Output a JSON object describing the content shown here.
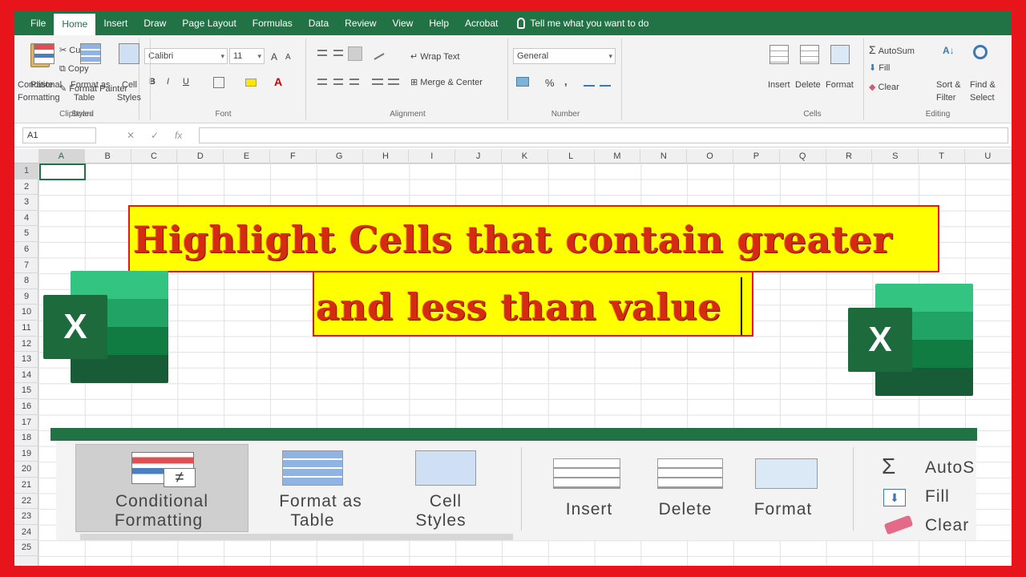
{
  "ribbon_tabs": [
    "File",
    "Home",
    "Insert",
    "Draw",
    "Page Layout",
    "Formulas",
    "Data",
    "Review",
    "View",
    "Help",
    "Acrobat"
  ],
  "tell_me": "Tell me what you want to do",
  "clipboard": {
    "paste": "Paste",
    "cut": "Cut",
    "copy": "Copy",
    "format_painter": "Format Painter",
    "label": "Clipboard"
  },
  "font": {
    "name": "Calibri",
    "size": "11",
    "label": "Font",
    "grow": "A",
    "shrink": "A",
    "bold": "B",
    "italic": "I",
    "underline": "U",
    "font_color": "A"
  },
  "alignment": {
    "wrap": "Wrap Text",
    "merge": "Merge & Center",
    "label": "Alignment"
  },
  "number": {
    "format": "General",
    "percent": "%",
    "comma": ",",
    "label": "Number"
  },
  "styles": {
    "conditional": "Conditional",
    "formatting": "Formatting",
    "format_as": "Format as",
    "table": "Table",
    "cell": "Cell",
    "cell_styles": "Styles",
    "label": "Styles"
  },
  "cells_group": {
    "insert": "Insert",
    "delete": "Delete",
    "format": "Format",
    "label": "Cells"
  },
  "editing": {
    "autosum": "AutoSum",
    "fill": "Fill",
    "clear": "Clear",
    "sort": "Sort &",
    "filter": "Filter",
    "find": "Find &",
    "select": "Select",
    "label": "Editing"
  },
  "formula_bar": {
    "name_box": "A1",
    "fx": "fx"
  },
  "columns": [
    "A",
    "B",
    "C",
    "D",
    "E",
    "F",
    "G",
    "H",
    "I",
    "J",
    "K",
    "L",
    "M",
    "N",
    "O",
    "P",
    "Q",
    "R",
    "S",
    "T",
    "U"
  ],
  "rows": [
    "1",
    "2",
    "3",
    "4",
    "5",
    "6",
    "7",
    "8",
    "9",
    "10",
    "11",
    "12",
    "13",
    "14",
    "15",
    "16",
    "17",
    "18",
    "19",
    "20",
    "21",
    "22",
    "23",
    "24",
    "25"
  ],
  "title_line1": "Highlight Cells that contain greater",
  "title_line2": "and less than value",
  "logo_letter": "X",
  "zoom": {
    "conditional_1": "Conditional",
    "conditional_2": "Formatting",
    "format_as_1": "Format as",
    "format_as_2": "Table",
    "cell_1": "Cell",
    "cell_2": "Styles",
    "insert": "Insert",
    "delete": "Delete",
    "format": "Format",
    "autosum": "AutoS",
    "fill": "Fill",
    "clear": "Clear",
    "sigma": "Σ"
  },
  "colors": {
    "excel_green": "#217346",
    "frame_red": "#e8141c",
    "banner_yellow": "#ffff00",
    "title_red": "#d42b12"
  }
}
